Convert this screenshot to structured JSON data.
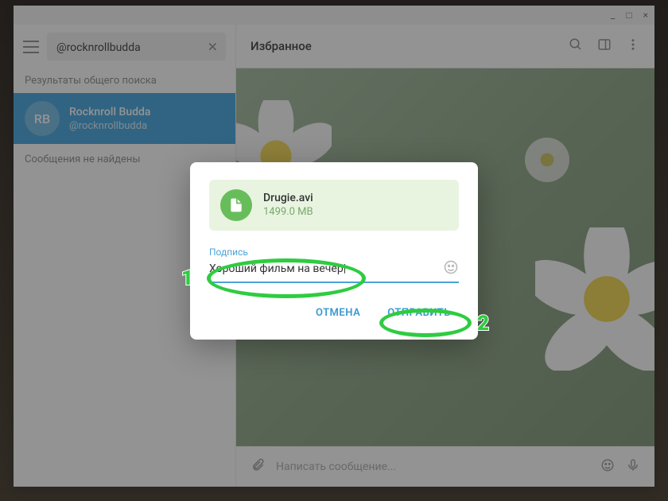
{
  "window": {
    "minimize": "_",
    "maximize": "□",
    "close": "×"
  },
  "sidebar": {
    "search_value": "@rocknrollbudda",
    "results_header": "Результаты общего поиска",
    "contact": {
      "avatar_initials": "RB",
      "name": "Rocknroll Budda",
      "username": "@rocknrollbudda"
    },
    "no_messages": "Сообщения не найдены"
  },
  "chat": {
    "title": "Избранное",
    "compose_placeholder": "Написать сообщение..."
  },
  "dialog": {
    "file": {
      "name": "Drugie.avi",
      "size": "1499.0 MB"
    },
    "caption_label": "Подпись",
    "caption_value": "Хороший фильм на вечер",
    "cancel": "ОТМЕНА",
    "send": "ОТПРАВИТЬ"
  },
  "annotations": {
    "n1": "1",
    "n2": "2"
  }
}
